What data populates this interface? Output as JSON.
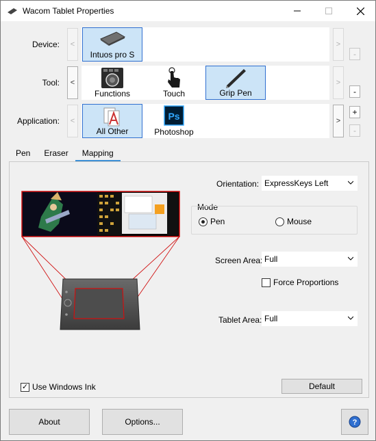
{
  "window": {
    "title": "Wacom Tablet Properties"
  },
  "rows": {
    "device": {
      "label": "Device:",
      "tiles": [
        {
          "label": "Intuos pro S",
          "icon": "tablet-icon",
          "selected": true
        }
      ]
    },
    "tool": {
      "label": "Tool:",
      "tiles": [
        {
          "label": "Functions",
          "icon": "functions-icon",
          "selected": false
        },
        {
          "label": "Touch",
          "icon": "touch-hand-icon",
          "selected": false
        },
        {
          "label": "Grip Pen",
          "icon": "grip-pen-icon",
          "selected": true
        }
      ]
    },
    "application": {
      "label": "Application:",
      "tiles": [
        {
          "label": "All Other",
          "icon": "all-other-apps-icon",
          "selected": true
        },
        {
          "label": "Photoshop",
          "icon": "photoshop-icon",
          "selected": false
        }
      ]
    }
  },
  "side_buttons": {
    "minus": "-",
    "plus": "+",
    "left": "<",
    "right": ">"
  },
  "tabs": [
    {
      "label": "Pen"
    },
    {
      "label": "Eraser"
    },
    {
      "label": "Mapping",
      "active": true
    }
  ],
  "mapping": {
    "orientation_label": "Orientation:",
    "orientation_value": "ExpressKeys Left",
    "mode_label": "Mode",
    "mode_pen": "Pen",
    "mode_mouse": "Mouse",
    "mode_selected": "Pen",
    "screen_area_label": "Screen Area:",
    "screen_area_value": "Full",
    "force_proportions_label": "Force Proportions",
    "force_proportions_checked": false,
    "tablet_area_label": "Tablet Area:",
    "tablet_area_value": "Full",
    "use_windows_ink_label": "Use Windows Ink",
    "use_windows_ink_checked": true,
    "default_button": "Default"
  },
  "footer": {
    "about": "About",
    "options": "Options...",
    "help_icon": "help-icon"
  },
  "colors": {
    "selection_bg": "#cce4f7",
    "selection_border": "#2f6fd0",
    "mapping_line": "#d01010",
    "tab_underline": "#3c8fd6"
  }
}
